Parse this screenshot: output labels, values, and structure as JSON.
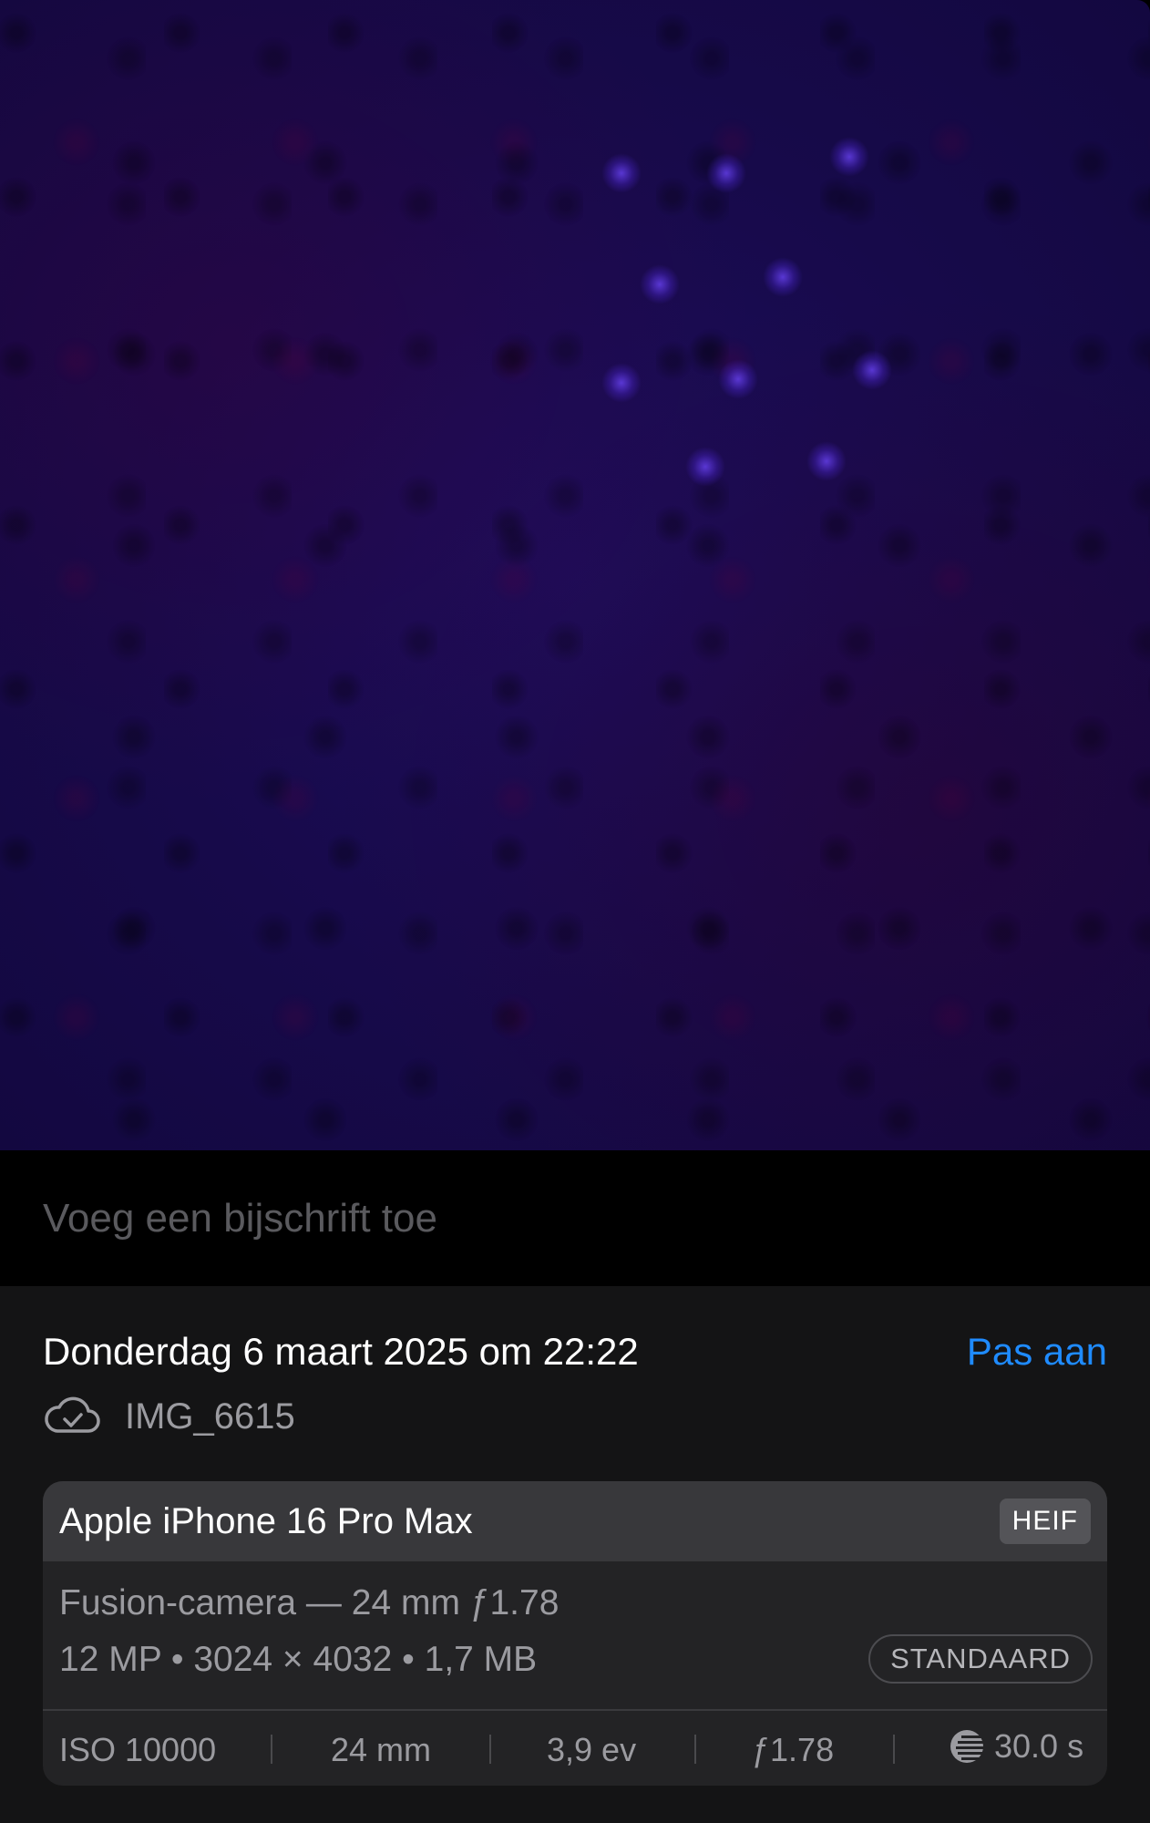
{
  "photo": {
    "description_colors": {
      "base": "#170a4a",
      "dot": "#6e46ff"
    }
  },
  "caption": {
    "placeholder": "Voeg een bijschrift toe",
    "value": ""
  },
  "info": {
    "date": "Donderdag 6 maart 2025 om 22:22",
    "adjust_label": "Pas aan",
    "filename": "IMG_6615",
    "icon": "icloud-check-icon"
  },
  "camera": {
    "device": "Apple iPhone 16 Pro Max",
    "format": "HEIF",
    "lens": "Fusion-camera — 24 mm ƒ1.78",
    "specs": "12 MP  •  3024 × 4032  •  1,7 MB",
    "style": "STANDAARD",
    "exif": {
      "iso": "ISO 10000",
      "focal": "24 mm",
      "ev": "3,9 ev",
      "aperture": "ƒ1.78",
      "shutter": "30.0 s"
    }
  },
  "colors": {
    "accent": "#1f8bff"
  }
}
